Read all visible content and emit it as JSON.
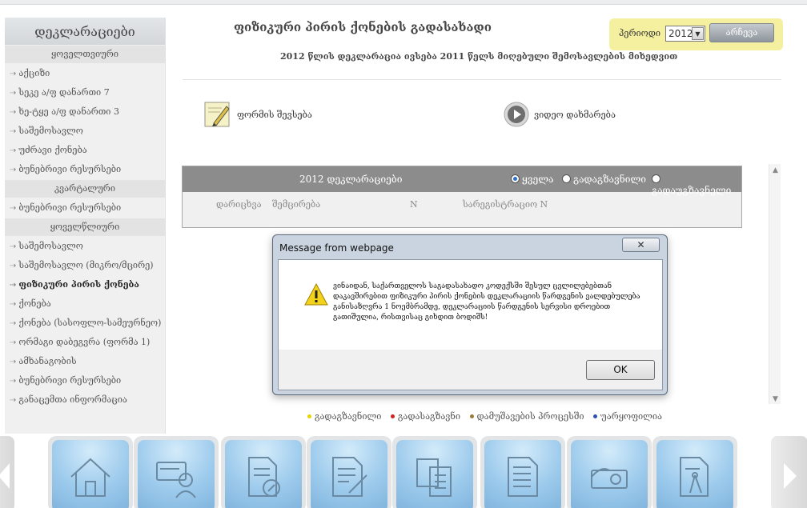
{
  "sidebar": {
    "title": "დეკლარაციები",
    "sections": [
      {
        "title": "ყოველთვიური",
        "items": [
          {
            "label": "აქციზი"
          },
          {
            "label": "სეკე ა/ფ დანართი 7"
          },
          {
            "label": "ხე-ტყე ა/ფ დანართი 3"
          },
          {
            "label": "საშემოსავლო"
          },
          {
            "label": "უძრავი ქონება"
          },
          {
            "label": "ბუნებრივი რესურსები"
          }
        ]
      },
      {
        "title": "კვარტალური",
        "items": [
          {
            "label": "ბუნებრივი რესურსები"
          }
        ]
      },
      {
        "title": "ყოველწლიური",
        "items": [
          {
            "label": "საშემოსავლო"
          },
          {
            "label": "საშემოსავლო (მიკრო/მცირე)"
          },
          {
            "label": "ფიზიკური პირის ქონება"
          },
          {
            "label": "ქონება"
          },
          {
            "label": "ქონება (სასოფლო-სამეურნეო)"
          },
          {
            "label": "ორმაგი დაბეგვრა (ფორმა 1)"
          },
          {
            "label": "ამხანაგობის"
          },
          {
            "label": "ბუნებრივი რესურსები"
          },
          {
            "label": "განაცემთა ინფორმაცია"
          }
        ]
      }
    ]
  },
  "main": {
    "title": "ფიზიკური პირის ქონების გადასახადი",
    "subtitle": "2012 წლის დეკლარაცია ივსება 2011 წელს მიღებული შემოსავლების მიხედვით"
  },
  "period": {
    "label": "პერიოდი",
    "selected": "2012",
    "button": "არჩევა"
  },
  "actions": {
    "fill_form": "ფორმის შევსება",
    "video_help": "ვიდეო დახმარება"
  },
  "declarations": {
    "title": "2012 დეკლარაციები",
    "filters": [
      "ყველა",
      "გადაგზავნილი",
      "გადაუგზავნელი"
    ],
    "selected_filter": "ყველა",
    "columns": [
      "დარიცხვა",
      "შემცირება",
      "N",
      "სარეგისტრაციო N"
    ]
  },
  "legend": [
    {
      "label": "გადაგზავნილი",
      "color": "#e6d400"
    },
    {
      "label": "გადასაგზავნი",
      "color": "#d42020"
    },
    {
      "label": "დამუშავების პროცესში",
      "color": "#9a7a3a"
    },
    {
      "label": "უარყოფილია",
      "color": "#3050b0"
    }
  ],
  "dialog": {
    "title": "Message from webpage",
    "close": "✕",
    "message": "ვინაიდან, საქართველოს საგადასახადო კოდექსში შესულ ცვლილებებთან დაკავშირებით ფიზიკური პირის ქონების დეკლარაციის წარდგენის ვალდებულება განისაზღვრა 1 ნოემბრამდე, დეკლარაციის წარდგენის სერვისი დროებით გათიშულია, რისთვისაც გიხდით ბოდიშს!",
    "ok": "OK"
  },
  "tiles": [
    "home-icon",
    "tax-card-icon",
    "tax-document-icon",
    "edit-document-icon",
    "documents-icon",
    "form-document-icon",
    "money-card-icon",
    "drafting-document-icon"
  ],
  "colors": {
    "accent": "#f4f0a0",
    "tile": "#9ccaec",
    "panel_header": "#8c8c8c"
  }
}
